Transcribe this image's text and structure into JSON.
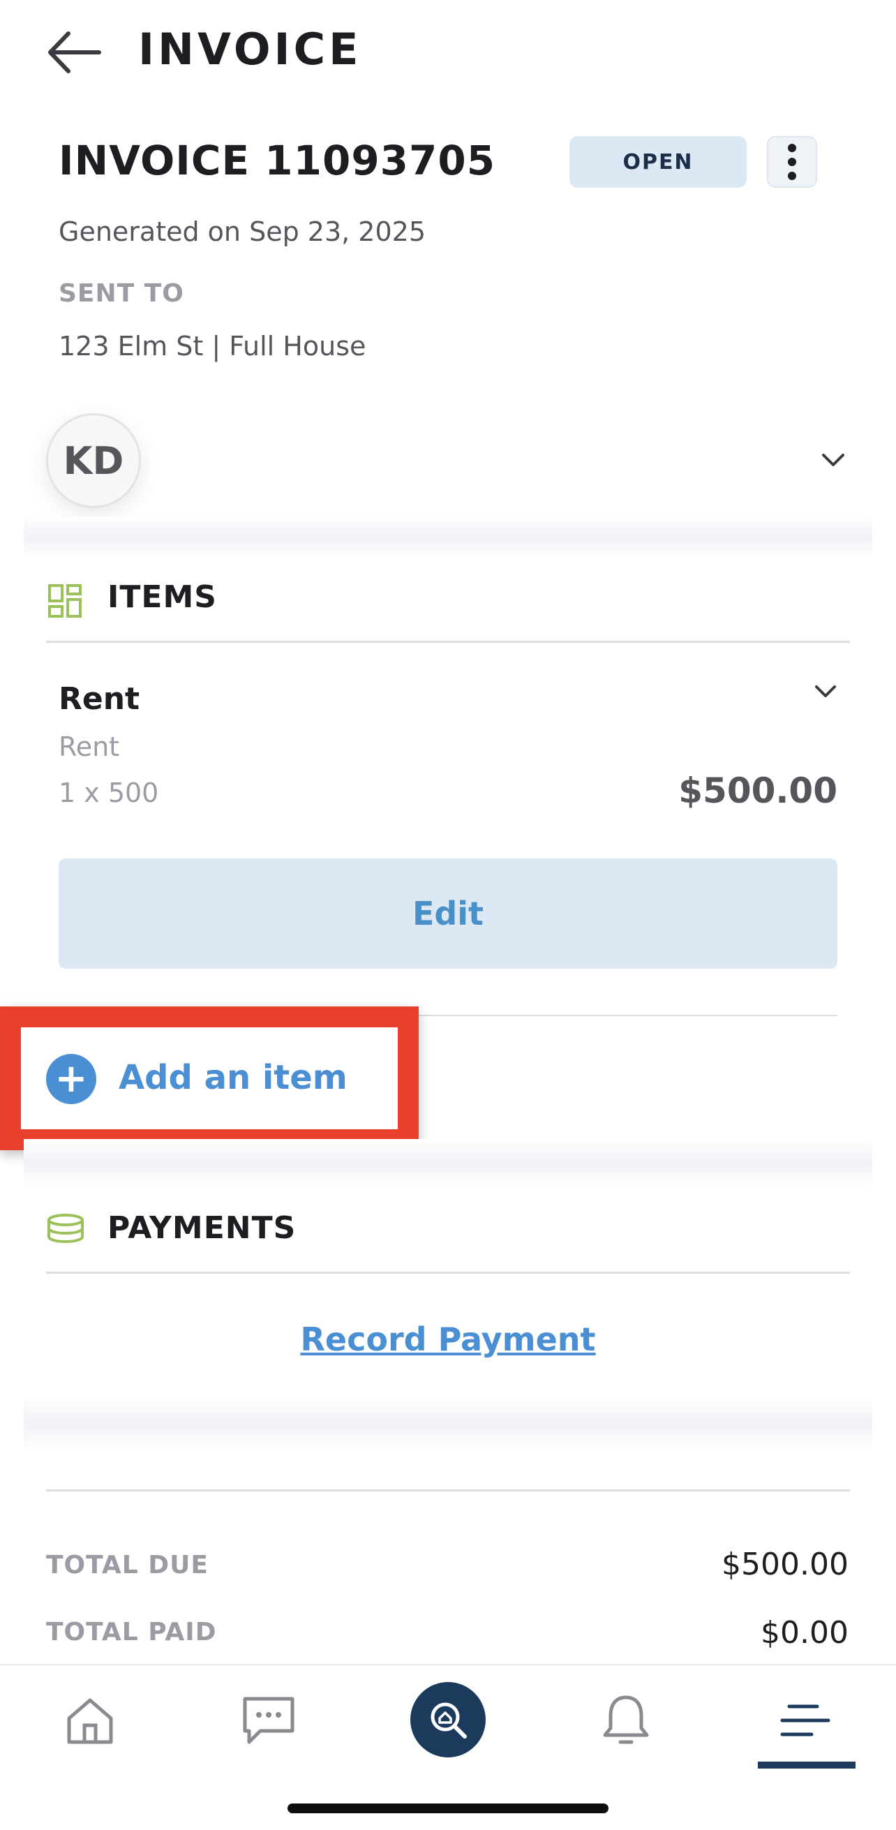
{
  "header": {
    "title": "INVOICE"
  },
  "invoice": {
    "number_label": "INVOICE 11093705",
    "status": "OPEN",
    "generated": "Generated on Sep 23, 2025",
    "sent_to_label": "SENT TO",
    "sent_to_value": "123 Elm St | Full House",
    "avatar_initials": "KD"
  },
  "items_section": {
    "title": "ITEMS",
    "items": [
      {
        "name": "Rent",
        "subtitle": "Rent",
        "quantity": "1 x 500",
        "amount": "$500.00"
      }
    ],
    "edit_label": "Edit",
    "add_item_label": "Add an item"
  },
  "payments_section": {
    "title": "PAYMENTS",
    "record_payment_label": "Record Payment"
  },
  "totals": {
    "total_due_label": "TOTAL DUE",
    "total_due_value": "$500.00",
    "total_paid_label": "TOTAL PAID",
    "total_paid_value": "$0.00"
  },
  "bottom_nav": {
    "items": [
      "home-icon",
      "messages-icon",
      "search-property-icon",
      "notifications-icon",
      "menu-icon"
    ],
    "active": "menu-icon"
  },
  "colors": {
    "accent": "#4a8fd3",
    "navy": "#1b3a5c",
    "badge_bg": "#dce9f5",
    "highlight": "#e8402a",
    "icon_green": "#9bc25a"
  }
}
